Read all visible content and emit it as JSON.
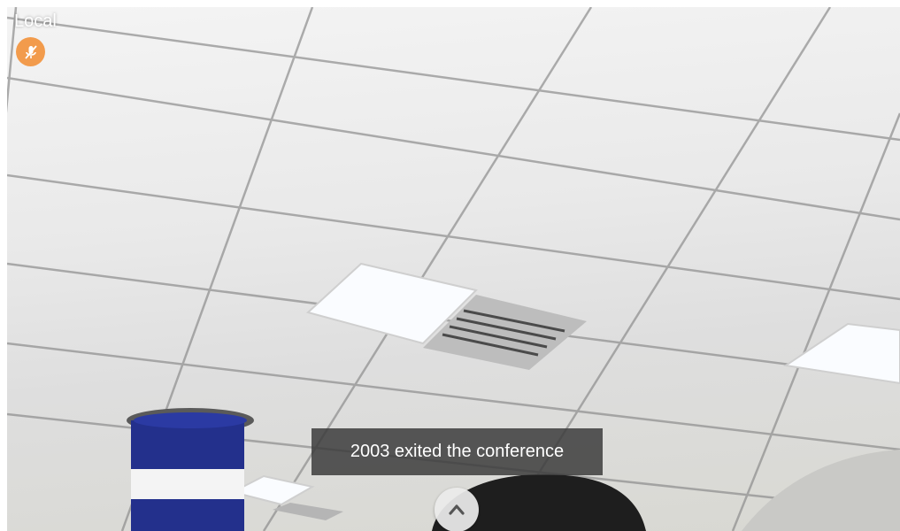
{
  "video": {
    "local_label": "Local",
    "mute_icon": "mic-muted-icon",
    "mute_badge_color": "#f29b4c"
  },
  "notification": {
    "message": "2003 exited the conference"
  },
  "controls": {
    "expand_icon": "chevron-up-icon"
  }
}
